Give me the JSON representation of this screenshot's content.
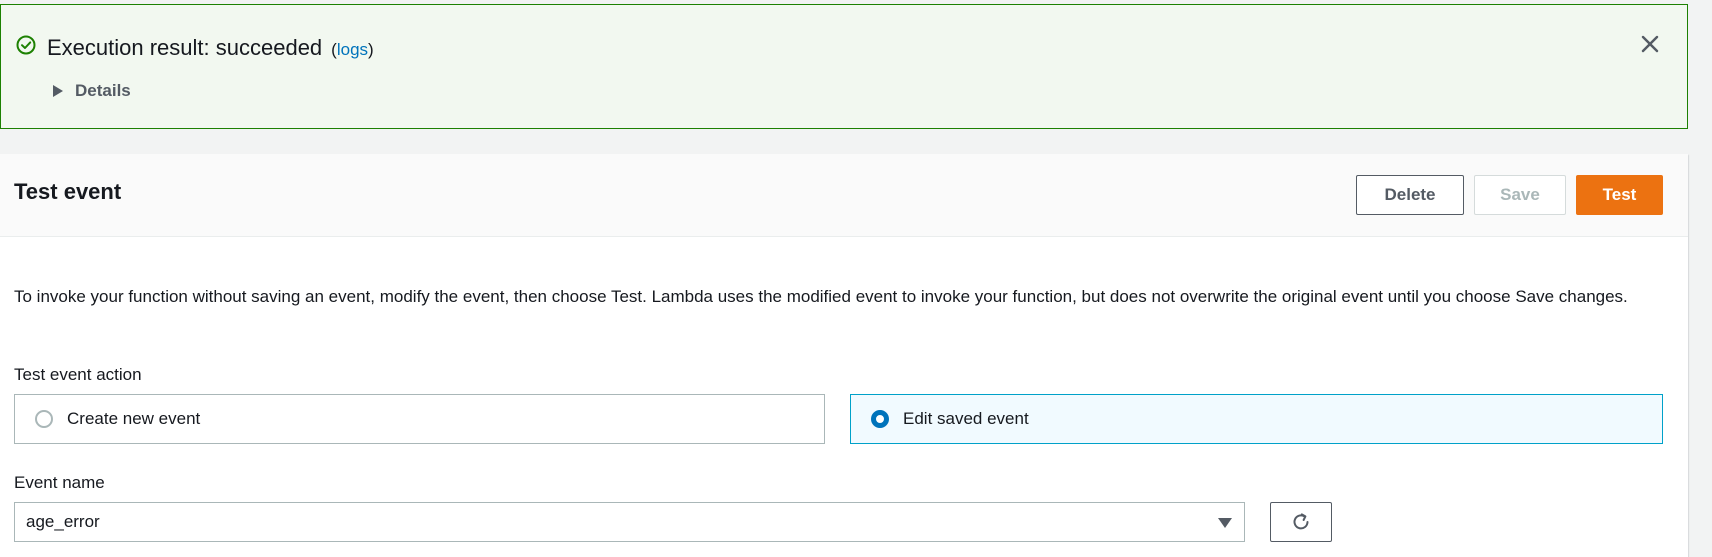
{
  "banner": {
    "title": "Execution result: succeeded",
    "logs_open": "(",
    "logs_link": "logs",
    "logs_close": ")",
    "details_label": "Details",
    "status": "success",
    "status_color": "#1d8102",
    "icons": {
      "status": "check-circle-icon",
      "close": "close-icon",
      "expand": "caret-right-icon"
    }
  },
  "panel": {
    "title": "Test event",
    "buttons": {
      "delete_label": "Delete",
      "save_label": "Save",
      "test_label": "Test"
    },
    "accent_color": "#ec7211",
    "description": "To invoke your function without saving an event, modify the event, then choose Test. Lambda uses the modified event to invoke your function, but does not overwrite the original event until you choose Save changes.",
    "action": {
      "label": "Test event action",
      "options": [
        {
          "label": "Create new event",
          "selected": false
        },
        {
          "label": "Edit saved event",
          "selected": true
        }
      ]
    },
    "event_name": {
      "label": "Event name",
      "value": "age_error"
    },
    "refresh_icon": "refresh-icon"
  }
}
